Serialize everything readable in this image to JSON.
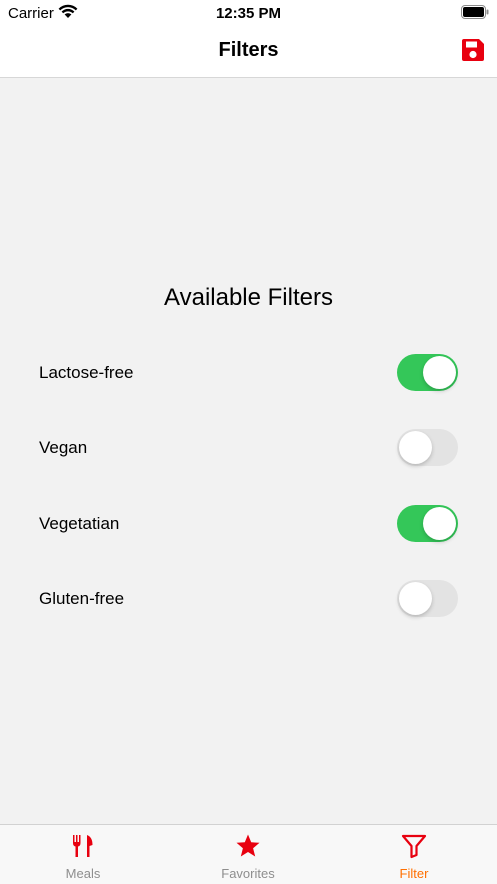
{
  "status_bar": {
    "carrier": "Carrier",
    "time": "12:35 PM"
  },
  "nav": {
    "title": "Filters",
    "save_icon": "floppy-disk-icon"
  },
  "main": {
    "section_title": "Available Filters",
    "filters": [
      {
        "label": "Lactose-free",
        "enabled": true
      },
      {
        "label": "Vegan",
        "enabled": false
      },
      {
        "label": "Vegetatian",
        "enabled": true
      },
      {
        "label": "Gluten-free",
        "enabled": false
      }
    ]
  },
  "tab_bar": {
    "tabs": [
      {
        "label": "Meals",
        "icon": "fork-knife-icon",
        "active": false
      },
      {
        "label": "Favorites",
        "icon": "star-icon",
        "active": false
      },
      {
        "label": "Filter",
        "icon": "filter-funnel-icon",
        "active": true
      }
    ]
  },
  "colors": {
    "accent_red": "#e8000f",
    "switch_on": "#34c759",
    "switch_off": "#e3e3e3",
    "tab_active": "#ff6f00",
    "tab_inactive": "#8e8e8e"
  }
}
